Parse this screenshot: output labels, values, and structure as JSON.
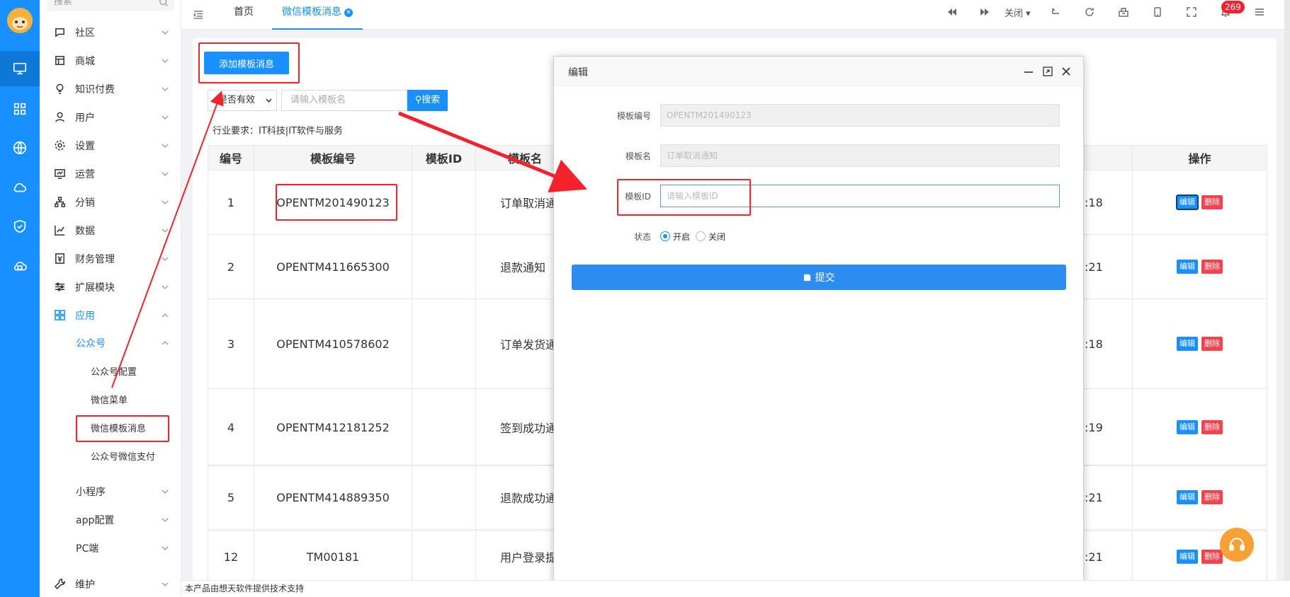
{
  "menu": {
    "search_placeholder": "搜索",
    "items": [
      {
        "label": "社区",
        "icon": "chat-icon"
      },
      {
        "label": "商城",
        "icon": "store-icon"
      },
      {
        "label": "知识付费",
        "icon": "bulb-icon"
      },
      {
        "label": "用户",
        "icon": "user-icon"
      },
      {
        "label": "设置",
        "icon": "gear-icon"
      },
      {
        "label": "运营",
        "icon": "monitor-chart-icon"
      },
      {
        "label": "分销",
        "icon": "sitemap-icon"
      },
      {
        "label": "数据",
        "icon": "line-chart-icon"
      },
      {
        "label": "财务管理",
        "icon": "finance-icon"
      },
      {
        "label": "扩展模块",
        "icon": "sliders-icon"
      },
      {
        "label": "应用",
        "icon": "apps-icon"
      }
    ],
    "app_sub": [
      {
        "label": "公众号"
      },
      {
        "label": "小程序"
      },
      {
        "label": "app配置"
      },
      {
        "label": "PC端"
      }
    ],
    "gzh_sub": [
      {
        "label": "公众号配置"
      },
      {
        "label": "微信菜单"
      },
      {
        "label": "微信模板消息"
      },
      {
        "label": "公众号微信支付"
      }
    ],
    "maintain_label": "维护"
  },
  "topbar": {
    "tabs": [
      {
        "label": "首页"
      },
      {
        "label": "微信模板消息"
      }
    ],
    "close_label": "关闭",
    "badge": "269"
  },
  "toolbar": {
    "add_label": "添加模板消息",
    "status_select": "是否有效",
    "search_placeholder": "请输入模板名",
    "search_label": "搜索",
    "industry_note": "行业要求：IT科技|IT软件与服务"
  },
  "table": {
    "headers": [
      "编号",
      "模板编号",
      "模板ID",
      "模板名",
      "操作"
    ],
    "rows": [
      {
        "id": "1",
        "code": "OPENTM201490123",
        "tid": "",
        "name": "订单取消通知",
        "time": ":18"
      },
      {
        "id": "2",
        "code": "OPENTM411665300",
        "tid": "",
        "name": "退款通知",
        "time": ":21"
      },
      {
        "id": "3",
        "code": "OPENTM410578602",
        "tid": "",
        "name": "订单发货通知",
        "time": ":18"
      },
      {
        "id": "4",
        "code": "OPENTM412181252",
        "tid": "",
        "name": "签到成功通知",
        "time": ":19"
      },
      {
        "id": "5",
        "code": "OPENTM414889350",
        "tid": "",
        "name": "退款成功通知",
        "time": ":21"
      },
      {
        "id": "12",
        "code": "TM00181",
        "tid": "",
        "name": "用户登录提醒",
        "time": ":21"
      }
    ],
    "edit_label": "编辑",
    "delete_label": "删除"
  },
  "modal": {
    "title": "编辑",
    "fields": {
      "code_label": "模板编号",
      "code_value": "OPENTM201490123",
      "name_label": "模板名",
      "name_value": "订单取消通知",
      "tid_label": "模板ID",
      "tid_placeholder": "请输入模板ID",
      "status_label": "状态",
      "status_on": "开启",
      "status_off": "关闭"
    },
    "submit_label": "提交"
  },
  "footer": {
    "text": "本产品由想天软件提供技术支持"
  },
  "colors": {
    "primary": "#1890ff",
    "danger": "#f5222d",
    "annotation": "#f5222d"
  }
}
